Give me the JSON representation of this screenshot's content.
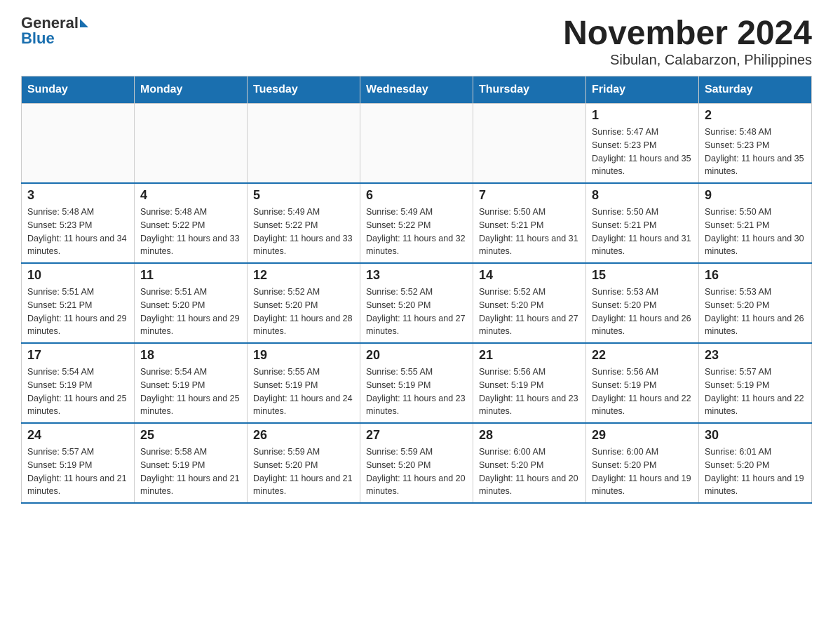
{
  "logo": {
    "text_general": "General",
    "text_blue": "Blue"
  },
  "title": "November 2024",
  "subtitle": "Sibulan, Calabarzon, Philippines",
  "weekdays": [
    "Sunday",
    "Monday",
    "Tuesday",
    "Wednesday",
    "Thursday",
    "Friday",
    "Saturday"
  ],
  "weeks": [
    [
      {
        "day": "",
        "sunrise": "",
        "sunset": "",
        "daylight": ""
      },
      {
        "day": "",
        "sunrise": "",
        "sunset": "",
        "daylight": ""
      },
      {
        "day": "",
        "sunrise": "",
        "sunset": "",
        "daylight": ""
      },
      {
        "day": "",
        "sunrise": "",
        "sunset": "",
        "daylight": ""
      },
      {
        "day": "",
        "sunrise": "",
        "sunset": "",
        "daylight": ""
      },
      {
        "day": "1",
        "sunrise": "Sunrise: 5:47 AM",
        "sunset": "Sunset: 5:23 PM",
        "daylight": "Daylight: 11 hours and 35 minutes."
      },
      {
        "day": "2",
        "sunrise": "Sunrise: 5:48 AM",
        "sunset": "Sunset: 5:23 PM",
        "daylight": "Daylight: 11 hours and 35 minutes."
      }
    ],
    [
      {
        "day": "3",
        "sunrise": "Sunrise: 5:48 AM",
        "sunset": "Sunset: 5:23 PM",
        "daylight": "Daylight: 11 hours and 34 minutes."
      },
      {
        "day": "4",
        "sunrise": "Sunrise: 5:48 AM",
        "sunset": "Sunset: 5:22 PM",
        "daylight": "Daylight: 11 hours and 33 minutes."
      },
      {
        "day": "5",
        "sunrise": "Sunrise: 5:49 AM",
        "sunset": "Sunset: 5:22 PM",
        "daylight": "Daylight: 11 hours and 33 minutes."
      },
      {
        "day": "6",
        "sunrise": "Sunrise: 5:49 AM",
        "sunset": "Sunset: 5:22 PM",
        "daylight": "Daylight: 11 hours and 32 minutes."
      },
      {
        "day": "7",
        "sunrise": "Sunrise: 5:50 AM",
        "sunset": "Sunset: 5:21 PM",
        "daylight": "Daylight: 11 hours and 31 minutes."
      },
      {
        "day": "8",
        "sunrise": "Sunrise: 5:50 AM",
        "sunset": "Sunset: 5:21 PM",
        "daylight": "Daylight: 11 hours and 31 minutes."
      },
      {
        "day": "9",
        "sunrise": "Sunrise: 5:50 AM",
        "sunset": "Sunset: 5:21 PM",
        "daylight": "Daylight: 11 hours and 30 minutes."
      }
    ],
    [
      {
        "day": "10",
        "sunrise": "Sunrise: 5:51 AM",
        "sunset": "Sunset: 5:21 PM",
        "daylight": "Daylight: 11 hours and 29 minutes."
      },
      {
        "day": "11",
        "sunrise": "Sunrise: 5:51 AM",
        "sunset": "Sunset: 5:20 PM",
        "daylight": "Daylight: 11 hours and 29 minutes."
      },
      {
        "day": "12",
        "sunrise": "Sunrise: 5:52 AM",
        "sunset": "Sunset: 5:20 PM",
        "daylight": "Daylight: 11 hours and 28 minutes."
      },
      {
        "day": "13",
        "sunrise": "Sunrise: 5:52 AM",
        "sunset": "Sunset: 5:20 PM",
        "daylight": "Daylight: 11 hours and 27 minutes."
      },
      {
        "day": "14",
        "sunrise": "Sunrise: 5:52 AM",
        "sunset": "Sunset: 5:20 PM",
        "daylight": "Daylight: 11 hours and 27 minutes."
      },
      {
        "day": "15",
        "sunrise": "Sunrise: 5:53 AM",
        "sunset": "Sunset: 5:20 PM",
        "daylight": "Daylight: 11 hours and 26 minutes."
      },
      {
        "day": "16",
        "sunrise": "Sunrise: 5:53 AM",
        "sunset": "Sunset: 5:20 PM",
        "daylight": "Daylight: 11 hours and 26 minutes."
      }
    ],
    [
      {
        "day": "17",
        "sunrise": "Sunrise: 5:54 AM",
        "sunset": "Sunset: 5:19 PM",
        "daylight": "Daylight: 11 hours and 25 minutes."
      },
      {
        "day": "18",
        "sunrise": "Sunrise: 5:54 AM",
        "sunset": "Sunset: 5:19 PM",
        "daylight": "Daylight: 11 hours and 25 minutes."
      },
      {
        "day": "19",
        "sunrise": "Sunrise: 5:55 AM",
        "sunset": "Sunset: 5:19 PM",
        "daylight": "Daylight: 11 hours and 24 minutes."
      },
      {
        "day": "20",
        "sunrise": "Sunrise: 5:55 AM",
        "sunset": "Sunset: 5:19 PM",
        "daylight": "Daylight: 11 hours and 23 minutes."
      },
      {
        "day": "21",
        "sunrise": "Sunrise: 5:56 AM",
        "sunset": "Sunset: 5:19 PM",
        "daylight": "Daylight: 11 hours and 23 minutes."
      },
      {
        "day": "22",
        "sunrise": "Sunrise: 5:56 AM",
        "sunset": "Sunset: 5:19 PM",
        "daylight": "Daylight: 11 hours and 22 minutes."
      },
      {
        "day": "23",
        "sunrise": "Sunrise: 5:57 AM",
        "sunset": "Sunset: 5:19 PM",
        "daylight": "Daylight: 11 hours and 22 minutes."
      }
    ],
    [
      {
        "day": "24",
        "sunrise": "Sunrise: 5:57 AM",
        "sunset": "Sunset: 5:19 PM",
        "daylight": "Daylight: 11 hours and 21 minutes."
      },
      {
        "day": "25",
        "sunrise": "Sunrise: 5:58 AM",
        "sunset": "Sunset: 5:19 PM",
        "daylight": "Daylight: 11 hours and 21 minutes."
      },
      {
        "day": "26",
        "sunrise": "Sunrise: 5:59 AM",
        "sunset": "Sunset: 5:20 PM",
        "daylight": "Daylight: 11 hours and 21 minutes."
      },
      {
        "day": "27",
        "sunrise": "Sunrise: 5:59 AM",
        "sunset": "Sunset: 5:20 PM",
        "daylight": "Daylight: 11 hours and 20 minutes."
      },
      {
        "day": "28",
        "sunrise": "Sunrise: 6:00 AM",
        "sunset": "Sunset: 5:20 PM",
        "daylight": "Daylight: 11 hours and 20 minutes."
      },
      {
        "day": "29",
        "sunrise": "Sunrise: 6:00 AM",
        "sunset": "Sunset: 5:20 PM",
        "daylight": "Daylight: 11 hours and 19 minutes."
      },
      {
        "day": "30",
        "sunrise": "Sunrise: 6:01 AM",
        "sunset": "Sunset: 5:20 PM",
        "daylight": "Daylight: 11 hours and 19 minutes."
      }
    ]
  ]
}
